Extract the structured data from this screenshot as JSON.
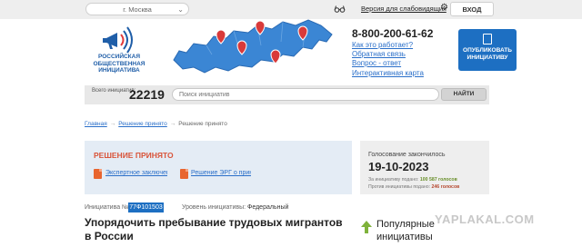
{
  "topbar": {
    "city": "г. Москва",
    "vision_link": "Версия для слабовидящих",
    "login": "ВХОД"
  },
  "header": {
    "logo_text": "РОССИЙСКАЯ ОБЩЕСТВЕННАЯ ИНИЦИАТИВА",
    "phone": "8-800-200-61-62",
    "links": [
      "Как это работает?",
      "Обратная связь",
      "Вопрос - ответ",
      "Интерактивная карта"
    ],
    "publish_button": "ОПУБЛИКОВАТЬ ИНИЦИАТИВУ"
  },
  "search": {
    "total_label": "Всего инициатив:",
    "total_count": "22219",
    "placeholder": "Поиск инициатив",
    "button": "НАЙТИ"
  },
  "breadcrumbs": [
    "Главная",
    "Решение принято",
    "Решение принято"
  ],
  "decision": {
    "title": "РЕШЕНИЕ ПРИНЯТО",
    "documents": [
      "Экспертное заключение",
      "Решение ЭРГ о принятии"
    ]
  },
  "voting": {
    "ended_label": "Голосование закончилось",
    "date": "19-10-2023",
    "for_label": "За инициативу подано:",
    "for_value": "100 587 голосов",
    "against_label": "Против инициативы подано:",
    "against_value": "246 голосов"
  },
  "initiative": {
    "number_label": "Инициатива №",
    "number": "77Ф101503",
    "level_label": "Уровень инициативы:",
    "level": "Федеральный",
    "title": "Упорядочить пребывание трудовых мигрантов в России"
  },
  "popular": {
    "title": "Популярные инициативы"
  },
  "watermark": "YAPLAKAL.COM",
  "colors": {
    "accent_blue": "#1d6fc2",
    "decision_red": "#d9543a",
    "vote_green": "#6a8f2b"
  }
}
